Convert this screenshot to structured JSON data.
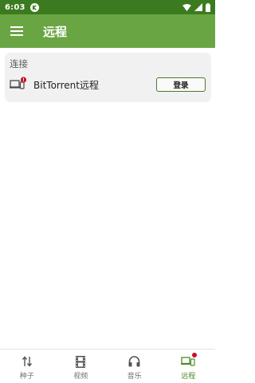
{
  "status_bar": {
    "time": "6:03",
    "icons": [
      "app-notification-icon",
      "wifi-icon",
      "signal-icon",
      "battery-icon"
    ]
  },
  "app_bar": {
    "title": "远程",
    "menu_icon": "menu-icon"
  },
  "connection_card": {
    "header": "连接",
    "device_label": "BitTorrent远程",
    "device_icon": "remote-device-warning-icon",
    "login_button": "登录"
  },
  "bottom_nav": {
    "items": [
      {
        "label": "种子",
        "icon": "transfer-arrows-icon"
      },
      {
        "label": "视频",
        "icon": "film-icon"
      },
      {
        "label": "音乐",
        "icon": "headphones-icon"
      },
      {
        "label": "远程",
        "icon": "remote-device-icon",
        "active": true,
        "badge": true
      }
    ]
  },
  "colors": {
    "status_bar": "#3c7a1f",
    "app_bar": "#6aa543",
    "accent": "#4f8a2b",
    "badge": "#c8102e"
  }
}
